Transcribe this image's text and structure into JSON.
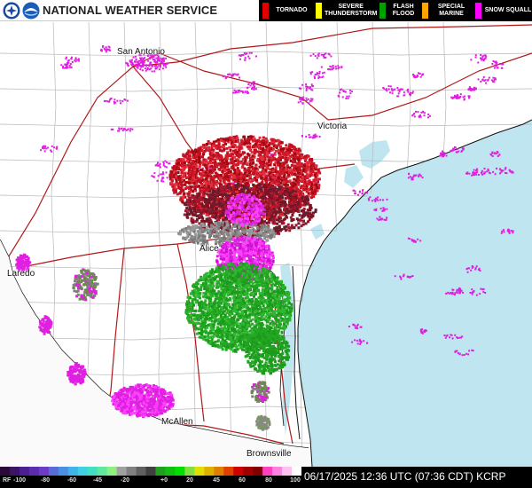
{
  "header": {
    "title": "NATIONAL WEATHER SERVICE",
    "logo_icons": [
      "nws-logo-icon",
      "noaa-logo-icon"
    ]
  },
  "warnings_legend": [
    {
      "label": "TORNADO",
      "color": "#e00000"
    },
    {
      "label": "SEVERE THUNDERSTORM",
      "color": "#ffff00"
    },
    {
      "label": "FLASH FLOOD",
      "color": "#00a000"
    },
    {
      "label": "SPECIAL MARINE",
      "color": "#ffa500"
    },
    {
      "label": "SNOW SQUALL",
      "color": "#ff00ff"
    }
  ],
  "map": {
    "cities": [
      "San Antonio",
      "Victoria",
      "Laredo",
      "Alice",
      "McAllen",
      "Brownsville"
    ],
    "colors": {
      "land": "#ffffff",
      "water": "#bfe6f0",
      "county_lines": "#b8b8b8",
      "highways": "#b01818",
      "border": "#000000",
      "rain": "#22a822",
      "mix": "#e020e0",
      "snow": "#c01020"
    }
  },
  "colorbar": {
    "prefix": "RF",
    "ticks": [
      "-100",
      "-80",
      "-60",
      "-45",
      "-20",
      "+0",
      "20",
      "45",
      "60",
      "80",
      "100"
    ]
  },
  "footer": {
    "timestamp": "06/17/2025 12:36 UTC (07:36 CDT) KCRP"
  }
}
